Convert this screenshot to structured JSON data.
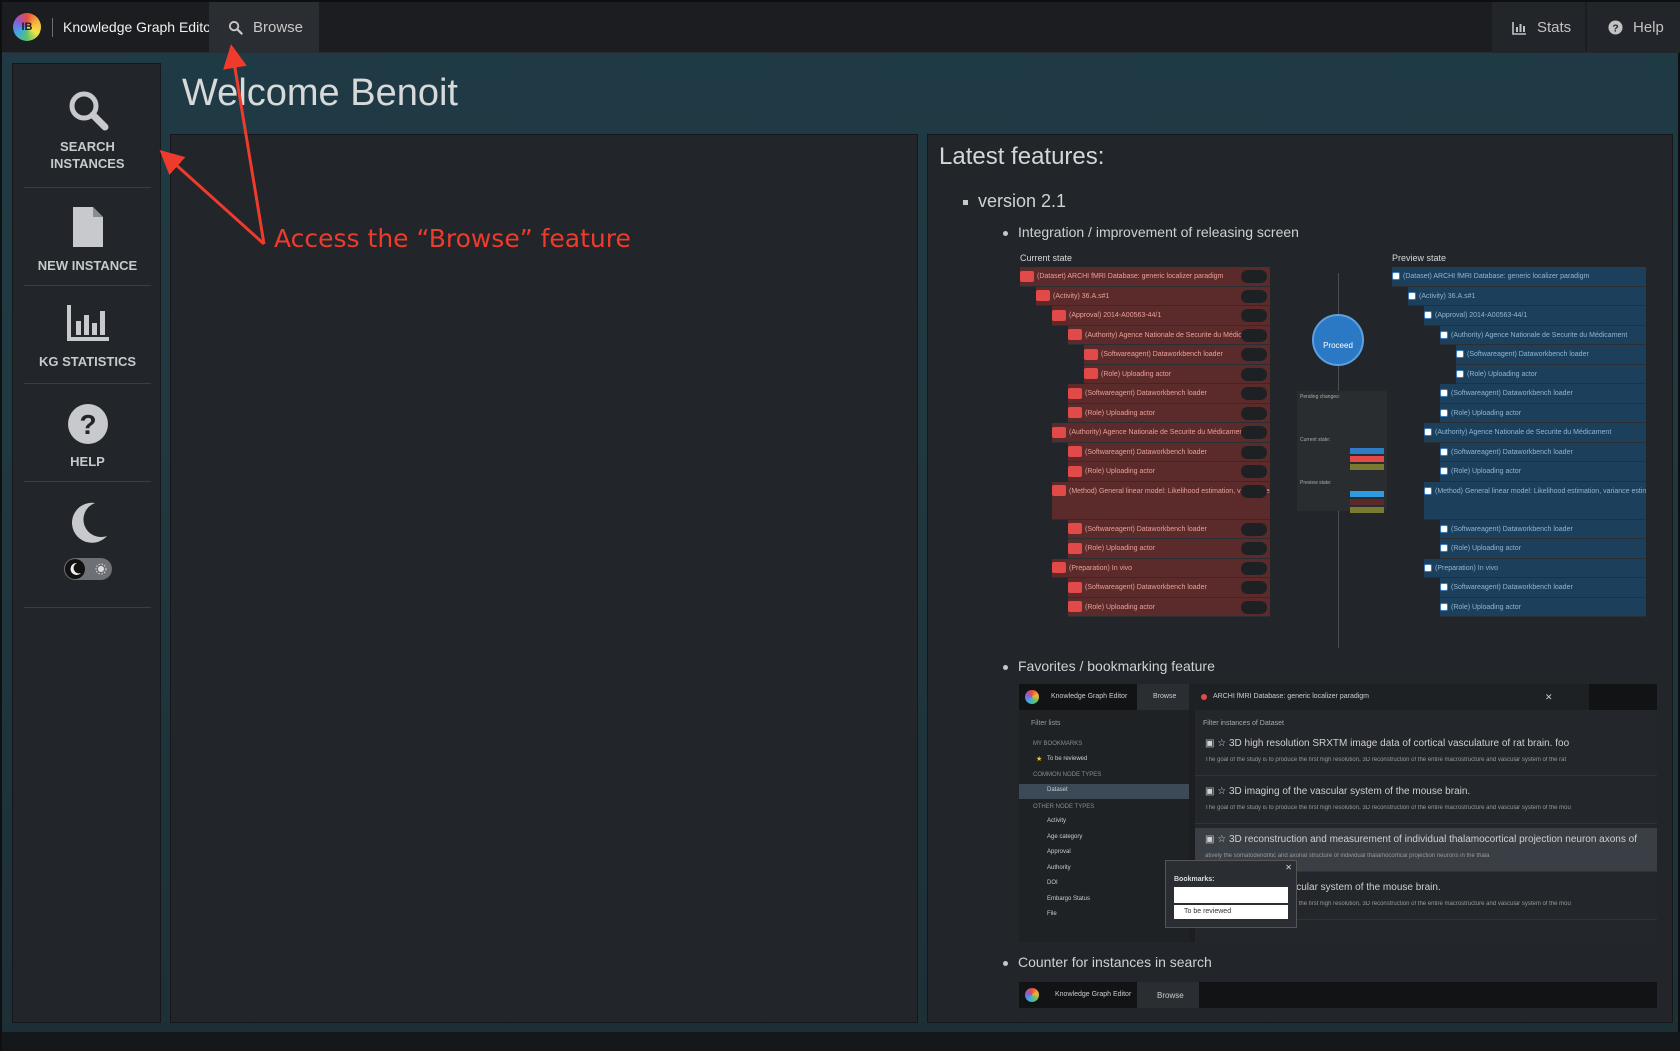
{
  "topbar": {
    "logo_text": "IB",
    "app_title": "Knowledge Graph Editor",
    "browse_tab": "Browse",
    "stats_label": "Stats",
    "help_label": "Help"
  },
  "sidenav": {
    "items": [
      {
        "label_line1": "SEARCH",
        "label_line2": "INSTANCES",
        "icon": "search-icon"
      },
      {
        "label": "NEW INSTANCE",
        "icon": "file-icon"
      },
      {
        "label": "KG STATISTICS",
        "icon": "bar-chart-icon"
      },
      {
        "label": "HELP",
        "icon": "question-circle-icon"
      }
    ],
    "theme_icon": "moon-icon"
  },
  "main": {
    "welcome": "Welcome Benoit"
  },
  "features": {
    "title": "Latest features:",
    "version": "version 2.1",
    "items": [
      "Integration / improvement of releasing screen",
      "Favorites / bookmarking feature",
      "Counter for instances in search"
    ],
    "release_preview": {
      "current_label": "Current state",
      "preview_label": "Preview state",
      "proceed": "Proceed",
      "rows": [
        "(Dataset) ARCHI fMRI Database: generic localizer paradigm",
        "(Activity) 36.A.s#1",
        "(Approval) 2014-A00563-44/1",
        "(Authority) Agence Nationale de Securite du Médicament",
        "(Softwareagent) Dataworkbench loader",
        "(Role) Uploading actor",
        "(Softwareagent) Dataworkbench loader",
        "(Role) Uploading actor",
        "(Authority) Agence Nationale de Securite du Médicament",
        "(Softwareagent) Dataworkbench loader",
        "(Role) Uploading actor",
        "(Method) General linear model: Likelihood estimation, variance estimation, statistical interference",
        "(Softwareagent) Dataworkbench loader",
        "(Role) Uploading actor",
        "(Preparation) In vivo",
        "(Softwareagent) Dataworkbench loader",
        "(Role) Uploading actor"
      ],
      "pending_title": "Pending changes:",
      "current_status": "Current state:",
      "preview_status": "Preview state:"
    },
    "bookmark_preview": {
      "app_title": "Knowledge Graph Editor",
      "browse": "Browse",
      "open_tab": "ARCHI fMRI Database: generic localizer paradigm",
      "filter_lists": "Filter lists",
      "my_bookmarks": "MY BOOKMARKS",
      "to_be_reviewed": "To be reviewed",
      "common_types": "COMMON NODE TYPES",
      "dataset": "Dataset",
      "other_types": "OTHER NODE TYPES",
      "types": [
        "Activity",
        "Age category",
        "Approval",
        "Authority",
        "DOI",
        "Embargo Status",
        "File"
      ],
      "filter_instances": "Filter instances of Dataset",
      "results": [
        {
          "title": "3D high resolution SRXTM image data of cortical vasculature of rat brain. foo",
          "desc": "The goal of the study is to produce the first high resolution, 3D reconstruction of the entire macrostructure and vascular system of the rat"
        },
        {
          "title": "3D imaging of the vascular system of the mouse brain.",
          "desc": "The goal of the study is to produce the first high resolution, 3D reconstruction of the entire macrostructure and vascular system of the mou"
        },
        {
          "title": "3D reconstruction and measurement of individual thalamocortical projection neuron axons of",
          "desc": "atively the somatodendritic and axonal structure of individual thalamocortical projection neurons in the thala"
        },
        {
          "title": "ction of the vascular system of the mouse brain.",
          "desc": "The goal of the study is to produce the first high resolution, 3D reconstruction of the entire macrostructure and vascular system of the mou"
        }
      ],
      "bookmarks_label": "Bookmarks:",
      "bookmark_option": "To be reviewed"
    },
    "counter_preview": {
      "app_title": "Knowledge Graph Editor",
      "browse": "Browse"
    }
  },
  "annotation": {
    "text": "Access the “Browse” feature",
    "color": "#ef3b2c"
  }
}
